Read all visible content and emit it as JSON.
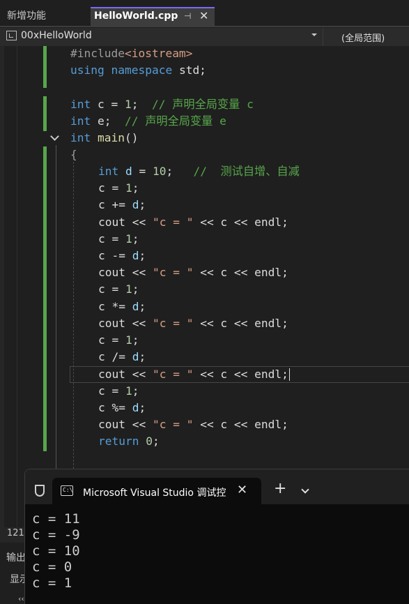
{
  "tabs": {
    "other_label": "新增功能",
    "active_label": "HelloWorld.cpp",
    "pin_glyph": "⊣",
    "close_glyph": "✕"
  },
  "navbar": {
    "project": "00xHelloWorld",
    "scope": "(全局范围)",
    "icon": "project-icon"
  },
  "code": {
    "l1": {
      "pp": "#include",
      "inc": "<iostream>"
    },
    "l2": {
      "kw1": "using",
      "kw2": "namespace",
      "rest": " std;"
    },
    "l4": {
      "kw": "int",
      "rest": " c = ",
      "num": "1",
      "semi": ";  ",
      "cm": "// 声明全局变量 c"
    },
    "l5": {
      "kw": "int",
      "rest": " e;  ",
      "cm": "// 声明全局变量 e"
    },
    "l6": {
      "kw": "int",
      "fn": "main",
      "rest": "()"
    },
    "l7": {
      "brace": "{"
    },
    "l8": {
      "kw": "int",
      "var": "d",
      "rest": " = ",
      "num": "10",
      "semi": ";   ",
      "cm": "//  测试自增、自减"
    },
    "stmts": [
      {
        "lhs": "c = ",
        "rhs": "1",
        "end": ";"
      },
      {
        "lhs": "c += ",
        "rhs": "d",
        "end": ";"
      },
      {
        "cout": "cout << ",
        "str": "\"c = \"",
        "tail": " << c << endl;"
      },
      {
        "lhs": "c = ",
        "rhs": "1",
        "end": ";"
      },
      {
        "lhs": "c -= ",
        "rhs": "d",
        "end": ";"
      },
      {
        "cout": "cout << ",
        "str": "\"c = \"",
        "tail": " << c << endl;"
      },
      {
        "lhs": "c = ",
        "rhs": "1",
        "end": ";"
      },
      {
        "lhs": "c *= ",
        "rhs": "d",
        "end": ";"
      },
      {
        "cout": "cout << ",
        "str": "\"c = \"",
        "tail": " << c << endl;"
      },
      {
        "lhs": "c = ",
        "rhs": "1",
        "end": ";"
      },
      {
        "lhs": "c /= ",
        "rhs": "d",
        "end": ";"
      },
      {
        "cout": "cout << ",
        "str": "\"c = \"",
        "tail": " << c << endl;"
      },
      {
        "lhs": "c = ",
        "rhs": "1",
        "end": ";"
      },
      {
        "lhs": "c %= ",
        "rhs": "d",
        "end": ";"
      },
      {
        "cout": "cout << ",
        "str": "\"c = \"",
        "tail": " << c << endl;"
      }
    ],
    "ret": {
      "kw": "return",
      "num": "0",
      "end": ";"
    }
  },
  "status": {
    "line": "121"
  },
  "output_pane": {
    "title": "输出",
    "show": "显示",
    "dots": "‹‹"
  },
  "console": {
    "tab_title": "Microsoft Visual Studio 调试控",
    "icon_text": "C:\\",
    "new_tab": "+",
    "lines": [
      "c = 11",
      "c = -9",
      "c = 10",
      "c = 0",
      "c = 1"
    ]
  },
  "colors": {
    "keyword": "#569cd6",
    "string": "#d69d85",
    "comment": "#57a64a",
    "number": "#b5cea8",
    "function": "#dcdcaa",
    "variable": "#9cdcfe",
    "change_bar": "#57a64a",
    "tab_accent": "#7a6cf0"
  }
}
